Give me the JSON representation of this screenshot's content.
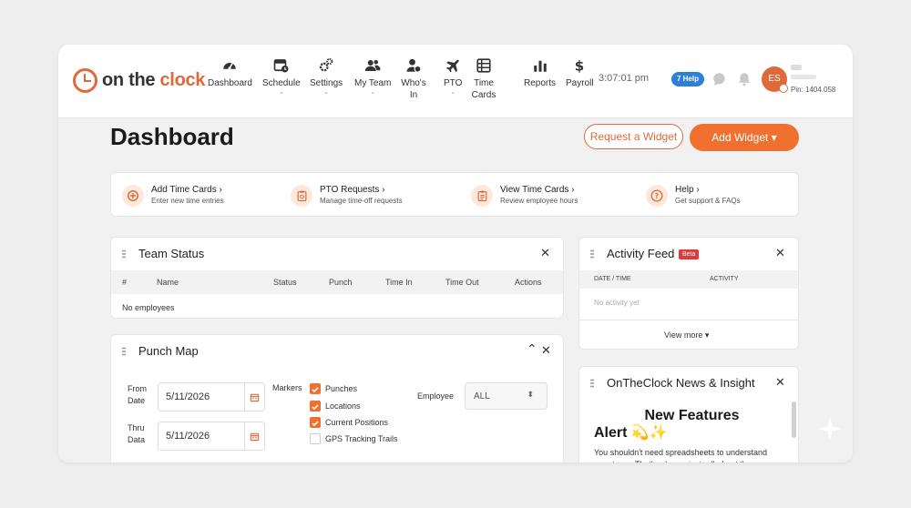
{
  "app": {
    "logo_on": "on",
    "logo_the": "the",
    "logo_clock": "clock",
    "brand_color": "#e0693a"
  },
  "nav": [
    {
      "label": "Dashboard",
      "icon": "gauge-icon",
      "dropdown": false
    },
    {
      "label": "Schedule",
      "icon": "calendar-clock-icon",
      "dropdown": true
    },
    {
      "label": "Settings",
      "icon": "gears-icon",
      "dropdown": true
    },
    {
      "label": "My Team",
      "icon": "team-icon",
      "dropdown": true
    },
    {
      "label": "Who's In",
      "icon": "user-status-icon",
      "dropdown": false
    },
    {
      "label": "PTO",
      "icon": "plane-icon",
      "dropdown": true
    },
    {
      "label": "Time Cards",
      "icon": "grid-card-icon",
      "dropdown": false
    },
    {
      "label": "Reports",
      "icon": "bar-chart-icon",
      "dropdown": false
    },
    {
      "label": "Payroll",
      "icon": "dollar-icon",
      "dropdown": false
    }
  ],
  "header": {
    "time": "3:07:01 pm",
    "help_badge": "7 Help",
    "avatar_initials": "ES",
    "pin": "Pin: 1404.058"
  },
  "page": {
    "title": "Dashboard",
    "request_widget": "Request a Widget",
    "add_widget": "Add Widget ▾"
  },
  "quick_actions": [
    {
      "title": "Add Time Cards",
      "subtitle": "Enter new time entries",
      "icon": "plus-circle-icon"
    },
    {
      "title": "PTO Requests",
      "subtitle": "Manage time-off requests",
      "icon": "clipboard-icon"
    },
    {
      "title": "View Time Cards",
      "subtitle": "Review employee hours",
      "icon": "list-clipboard-icon"
    },
    {
      "title": "Help",
      "subtitle": "Get support & FAQs",
      "icon": "question-icon"
    }
  ],
  "team_status": {
    "title": "Team Status",
    "columns": [
      "#",
      "Name",
      "Status",
      "Punch",
      "Time In",
      "Time Out",
      "Actions"
    ],
    "empty": "No employees"
  },
  "punch_map": {
    "title": "Punch Map",
    "from_label": "From Date",
    "from_line1": "From",
    "from_line2": "Date",
    "thru_line1": "Thru",
    "thru_line2": "Data",
    "from_value": "5/11/2026",
    "thru_value": "5/11/2026",
    "markers_label": "Markers",
    "markers": [
      {
        "label": "Punches",
        "checked": true
      },
      {
        "label": "Locations",
        "checked": true
      },
      {
        "label": "Current Positions",
        "checked": true
      },
      {
        "label": "GPS Tracking Trails",
        "checked": false
      }
    ],
    "employee_label": "Employee",
    "employee_value": "ALL"
  },
  "activity_feed": {
    "title": "Activity Feed",
    "badge": "Beta",
    "col_date": "DATE / TIME",
    "col_activity": "ACTIVITY",
    "empty": "No activity yet",
    "view_more": "View more ▾"
  },
  "news": {
    "title": "OnTheClock News & Insight",
    "headline": "New Features",
    "alert": "Alert 💫✨",
    "body": "You shouldn't need spreadsheets to understand your team. That's why we just rolled out those"
  }
}
